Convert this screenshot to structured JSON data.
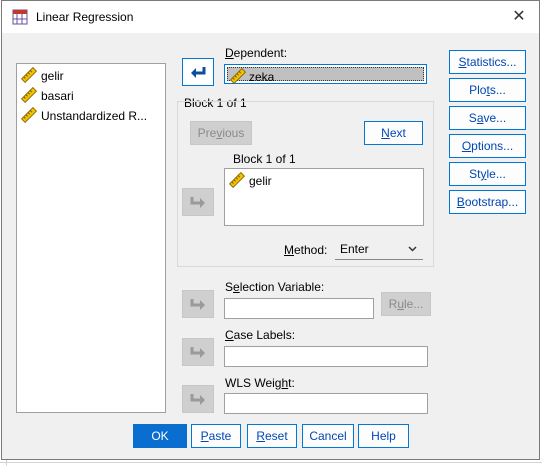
{
  "window": {
    "title": "Linear Regression",
    "close_glyph": "✕"
  },
  "variables": [
    {
      "name": "gelir",
      "icon": "scale-ruler-icon"
    },
    {
      "name": "basari",
      "icon": "scale-ruler-icon"
    },
    {
      "name": "Unstandardized R...",
      "icon": "scale-ruler-icon"
    }
  ],
  "dependent": {
    "label": "Dependent:",
    "value": "zeka"
  },
  "block": {
    "header": "Block 1 of 1",
    "previous": "Previous",
    "next": "Next",
    "inner_label": "Block 1 of 1",
    "independents": [
      "gelir"
    ]
  },
  "method": {
    "label": "Method:",
    "value": "Enter"
  },
  "selection_variable": {
    "label": "Selection Variable:",
    "rule": "Rule...",
    "value": ""
  },
  "case_labels": {
    "label": "Case Labels:",
    "value": ""
  },
  "wls_weight": {
    "label": "WLS Weight:",
    "value": ""
  },
  "side_buttons": [
    "Statistics...",
    "Plots...",
    "Save...",
    "Options...",
    "Style...",
    "Bootstrap..."
  ],
  "footer": {
    "ok": "OK",
    "paste": "Paste",
    "reset": "Reset",
    "cancel": "Cancel",
    "help": "Help"
  },
  "colors": {
    "accent": "#0078d7",
    "link_text": "#0047b3",
    "ok_bg": "#0a6ed1"
  }
}
